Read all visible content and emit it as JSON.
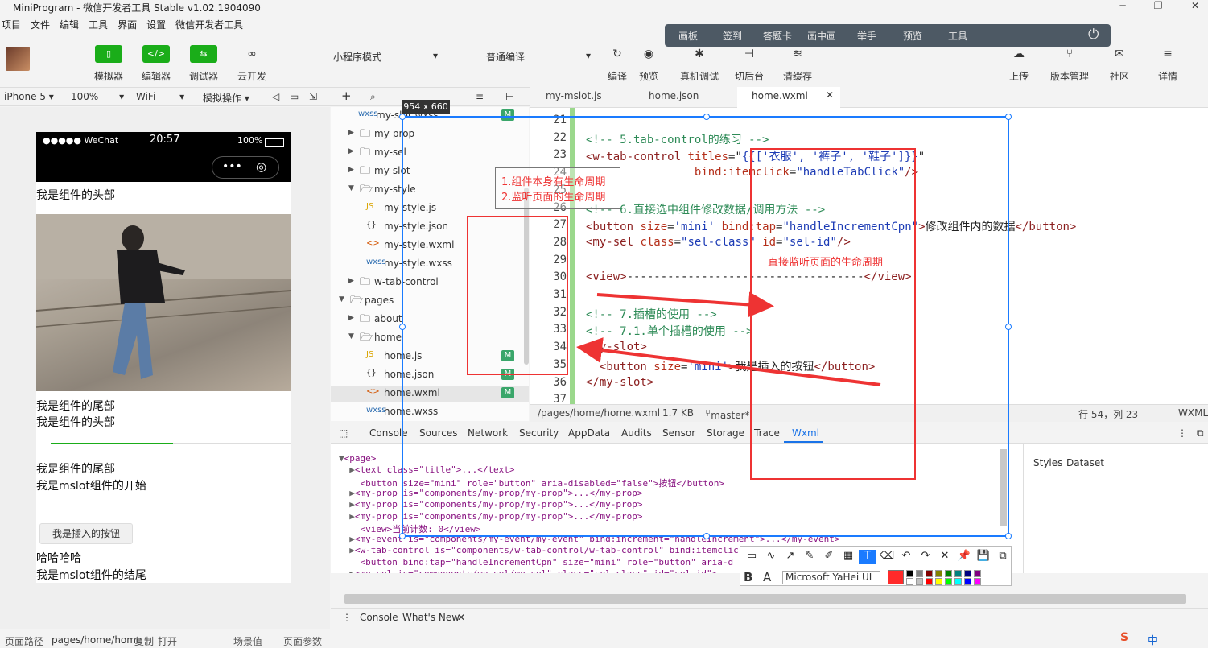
{
  "window": {
    "title": "MiniProgram - 微信开发者工具 Stable v1.02.1904090",
    "minimize": "─",
    "maximize": "❐",
    "close": "✕"
  },
  "menu": [
    "项目",
    "文件",
    "编辑",
    "工具",
    "界面",
    "设置",
    "微信开发者工具"
  ],
  "float_toolbar": {
    "items": [
      "画板",
      "签到",
      "答题卡",
      "画中画",
      "举手",
      "预览",
      "工具"
    ],
    "power_icon": "⏻"
  },
  "toolbar": {
    "left_buttons": [
      {
        "label": "模拟器",
        "icon": "▯"
      },
      {
        "label": "编辑器",
        "icon": "</>"
      },
      {
        "label": "调试器",
        "icon": "⇆"
      },
      {
        "label": "云开发",
        "icon": "∞"
      }
    ],
    "mode_select": "小程序模式",
    "compile_select": "普通编译",
    "mid_buttons": [
      {
        "label": "编译",
        "icon": "↻"
      },
      {
        "label": "预览",
        "icon": "◉"
      },
      {
        "label": "真机调试",
        "icon": "✱"
      },
      {
        "label": "切后台",
        "icon": "⊣"
      },
      {
        "label": "清缓存",
        "icon": "≋"
      }
    ],
    "right_buttons": [
      {
        "label": "上传",
        "icon": "☁"
      },
      {
        "label": "版本管理",
        "icon": "⑂"
      },
      {
        "label": "社区",
        "icon": "✉"
      },
      {
        "label": "详情",
        "icon": "≡"
      }
    ]
  },
  "subbar": {
    "device": "iPhone 5",
    "zoom": "100%",
    "network": "WiFi",
    "sim_ops": "模拟操作"
  },
  "phone": {
    "carrier": "●●●●● WeChat",
    "time": "20:57",
    "battery": "100%",
    "capsule_more": "•••",
    "capsule_close": "◎",
    "lines": [
      "我是组件的头部",
      "我是组件的尾部",
      "我是组件的头部",
      "我是组件的尾部",
      "我是mslot组件的开始"
    ],
    "inserted_button": "我是插入的按钮",
    "after_lines": [
      "哈哈哈哈",
      "我是mslot组件的结尾"
    ]
  },
  "filetree": {
    "rows": [
      {
        "type": "file",
        "name": "my-slot.wxss",
        "ext": "wxss",
        "indent": 1,
        "badge": "M"
      },
      {
        "type": "folder",
        "name": "my-prop",
        "open": false,
        "indent": 1
      },
      {
        "type": "folder",
        "name": "my-sel",
        "open": false,
        "indent": 1
      },
      {
        "type": "folder",
        "name": "my-slot",
        "open": false,
        "indent": 1
      },
      {
        "type": "folder",
        "name": "my-style",
        "open": true,
        "indent": 1
      },
      {
        "type": "file",
        "name": "my-style.js",
        "ext": "JS",
        "indent": 2
      },
      {
        "type": "file",
        "name": "my-style.json",
        "ext": "{}",
        "indent": 2
      },
      {
        "type": "file",
        "name": "my-style.wxml",
        "ext": "<>",
        "indent": 2
      },
      {
        "type": "file",
        "name": "my-style.wxss",
        "ext": "wxss",
        "indent": 2
      },
      {
        "type": "folder",
        "name": "w-tab-control",
        "open": false,
        "indent": 1
      },
      {
        "type": "folder",
        "name": "pages",
        "open": true,
        "indent": 0
      },
      {
        "type": "folder",
        "name": "about",
        "open": false,
        "indent": 1
      },
      {
        "type": "folder",
        "name": "home",
        "open": true,
        "indent": 1
      },
      {
        "type": "file",
        "name": "home.js",
        "ext": "JS",
        "indent": 2,
        "badge": "M"
      },
      {
        "type": "file",
        "name": "home.json",
        "ext": "{}",
        "indent": 2,
        "badge": "M"
      },
      {
        "type": "file",
        "name": "home.wxml",
        "ext": "<>",
        "indent": 2,
        "badge": "M",
        "selected": true
      },
      {
        "type": "file",
        "name": "home.wxss",
        "ext": "wxss",
        "indent": 2
      }
    ]
  },
  "editor_tabs": [
    "my-mslot.js",
    "home.json",
    "home.wxml"
  ],
  "editor": {
    "lines": [
      {
        "n": "21",
        "parts": []
      },
      {
        "n": "22",
        "parts": [
          {
            "c": "cm",
            "t": "<!-- 5.tab-control的练习 -->"
          }
        ]
      },
      {
        "n": "23",
        "parts": [
          {
            "c": "tg",
            "t": "<w-tab-control "
          },
          {
            "c": "at",
            "t": "titles"
          },
          {
            "c": "tx",
            "t": "=\""
          },
          {
            "c": "st",
            "t": "{{['衣服', '裤子', '鞋子']}}"
          },
          {
            "c": "tx",
            "t": "\""
          }
        ]
      },
      {
        "n": "24",
        "parts": [
          {
            "c": "tx",
            "t": "                "
          },
          {
            "c": "at",
            "t": "bind:itemclick"
          },
          {
            "c": "tx",
            "t": "="
          },
          {
            "c": "st",
            "t": "\"handleTabClick\""
          },
          {
            "c": "tg",
            "t": "/>"
          }
        ]
      },
      {
        "n": "25",
        "parts": []
      },
      {
        "n": "26",
        "parts": [
          {
            "c": "cm",
            "t": "<!-- 6.直接选中组件修改数据/调用方法 -->"
          }
        ]
      },
      {
        "n": "27",
        "parts": [
          {
            "c": "tg",
            "t": "<button "
          },
          {
            "c": "at",
            "t": "size"
          },
          {
            "c": "tx",
            "t": "="
          },
          {
            "c": "st",
            "t": "'mini'"
          },
          {
            "c": "tx",
            "t": " "
          },
          {
            "c": "at",
            "t": "bind:tap"
          },
          {
            "c": "tx",
            "t": "="
          },
          {
            "c": "st",
            "t": "\"handleIncrementCpn\""
          },
          {
            "c": "tg",
            "t": ">"
          },
          {
            "c": "tx",
            "t": "修改组件内的数据"
          },
          {
            "c": "tg",
            "t": "</button>"
          }
        ]
      },
      {
        "n": "28",
        "parts": [
          {
            "c": "tg",
            "t": "<my-sel "
          },
          {
            "c": "at",
            "t": "class"
          },
          {
            "c": "tx",
            "t": "="
          },
          {
            "c": "st",
            "t": "\"sel-class\""
          },
          {
            "c": "tx",
            "t": " "
          },
          {
            "c": "at",
            "t": "id"
          },
          {
            "c": "tx",
            "t": "="
          },
          {
            "c": "st",
            "t": "\"sel-id\""
          },
          {
            "c": "tg",
            "t": "/>"
          }
        ]
      },
      {
        "n": "29",
        "parts": []
      },
      {
        "n": "30",
        "parts": [
          {
            "c": "tg",
            "t": "<view>"
          },
          {
            "c": "tx",
            "t": "-----------------------------------"
          },
          {
            "c": "tg",
            "t": "</view>"
          }
        ]
      },
      {
        "n": "31",
        "parts": []
      },
      {
        "n": "32",
        "parts": [
          {
            "c": "cm",
            "t": "<!-- 7.插槽的使用 -->"
          }
        ]
      },
      {
        "n": "33",
        "parts": [
          {
            "c": "cm",
            "t": "<!-- 7.1.单个插槽的使用 -->"
          }
        ]
      },
      {
        "n": "34",
        "parts": [
          {
            "c": "tg",
            "t": "<my-slot>"
          }
        ]
      },
      {
        "n": "35",
        "parts": [
          {
            "c": "tx",
            "t": "  "
          },
          {
            "c": "tg",
            "t": "<button "
          },
          {
            "c": "at",
            "t": "size"
          },
          {
            "c": "tx",
            "t": "="
          },
          {
            "c": "st",
            "t": "'mini'"
          },
          {
            "c": "tg",
            "t": ">"
          },
          {
            "c": "tx",
            "t": "我是插入的按钮"
          },
          {
            "c": "tg",
            "t": "</button>"
          }
        ]
      },
      {
        "n": "36",
        "parts": [
          {
            "c": "tg",
            "t": "</my-slot>"
          }
        ]
      },
      {
        "n": "37",
        "parts": []
      }
    ]
  },
  "edit_status": {
    "path": "/pages/home/home.wxml",
    "size": "1.7 KB",
    "branch": "master*",
    "cursor": "行 54，列 23",
    "lang": "WXML"
  },
  "devtools_tabs": [
    "Console",
    "Sources",
    "Network",
    "Security",
    "AppData",
    "Audits",
    "Sensor",
    "Storage",
    "Trace",
    "Wxml"
  ],
  "wxml_tree": [
    {
      "a": "▼",
      "t": "<page>"
    },
    {
      "a": "  ▶",
      "t": "<text class=\"title\">...</text>"
    },
    {
      "a": "    ",
      "t": "<button size=\"mini\" role=\"button\" aria-disabled=\"false\">按钮</button>"
    },
    {
      "a": "  ▶",
      "t": "<my-prop is=\"components/my-prop/my-prop\">...</my-prop>"
    },
    {
      "a": "  ▶",
      "t": "<my-prop is=\"components/my-prop/my-prop\">...</my-prop>"
    },
    {
      "a": "  ▶",
      "t": "<my-prop is=\"components/my-prop/my-prop\">...</my-prop>"
    },
    {
      "a": "    ",
      "t": "<view>当前计数: 0</view>"
    },
    {
      "a": "  ▶",
      "t": "<my-event is=\"components/my-event/my-event\" bind:increment=\"handleIncrement\">...</my-event>"
    },
    {
      "a": "  ▶",
      "t": "<w-tab-control is=\"components/w-tab-control/w-tab-control\" bind:itemclick"
    },
    {
      "a": "    ",
      "t": "<button bind:tap=\"handleIncrementCpn\" size=\"mini\" role=\"button\" aria-d"
    },
    {
      "a": "  ▶",
      "t": "<my-sel is=\"components/my-sel/my-sel\" class=\"sel-class\" id=\"sel-id\">"
    }
  ],
  "styles_tabs": [
    "Styles",
    "Dataset"
  ],
  "drawer_tabs": [
    "Console",
    "What's New"
  ],
  "bottom": {
    "path_label": "页面路径",
    "path": "pages/home/home",
    "copy": "复制",
    "open": "打开",
    "scene": "场景值",
    "params": "页面参数"
  },
  "annotations": {
    "size_label": "954 x 660",
    "note_1": "1.组件本身有生命周期",
    "note_2": "2.监听页面的生命周期",
    "note_3": "直接监听页面的生命周期"
  },
  "draw_tools": {
    "icons": [
      "▭",
      "∿",
      "↗",
      "✎",
      "✐",
      "▦",
      "T",
      "⌫",
      "↶",
      "↷",
      "✕",
      "📌",
      "💾",
      "⧉"
    ],
    "bold": "B",
    "outline": "A",
    "font": "Microsoft YaHei UI",
    "colors": [
      "#000000",
      "#808080",
      "#800000",
      "#808000",
      "#008000",
      "#008080",
      "#000080",
      "#800080",
      "#ffffff",
      "#c0c0c0",
      "#ff0000",
      "#ffff00",
      "#00ff00",
      "#00ffff",
      "#0000ff",
      "#ff00ff"
    ],
    "current_color": "#ff2a2a"
  },
  "ime": "中"
}
